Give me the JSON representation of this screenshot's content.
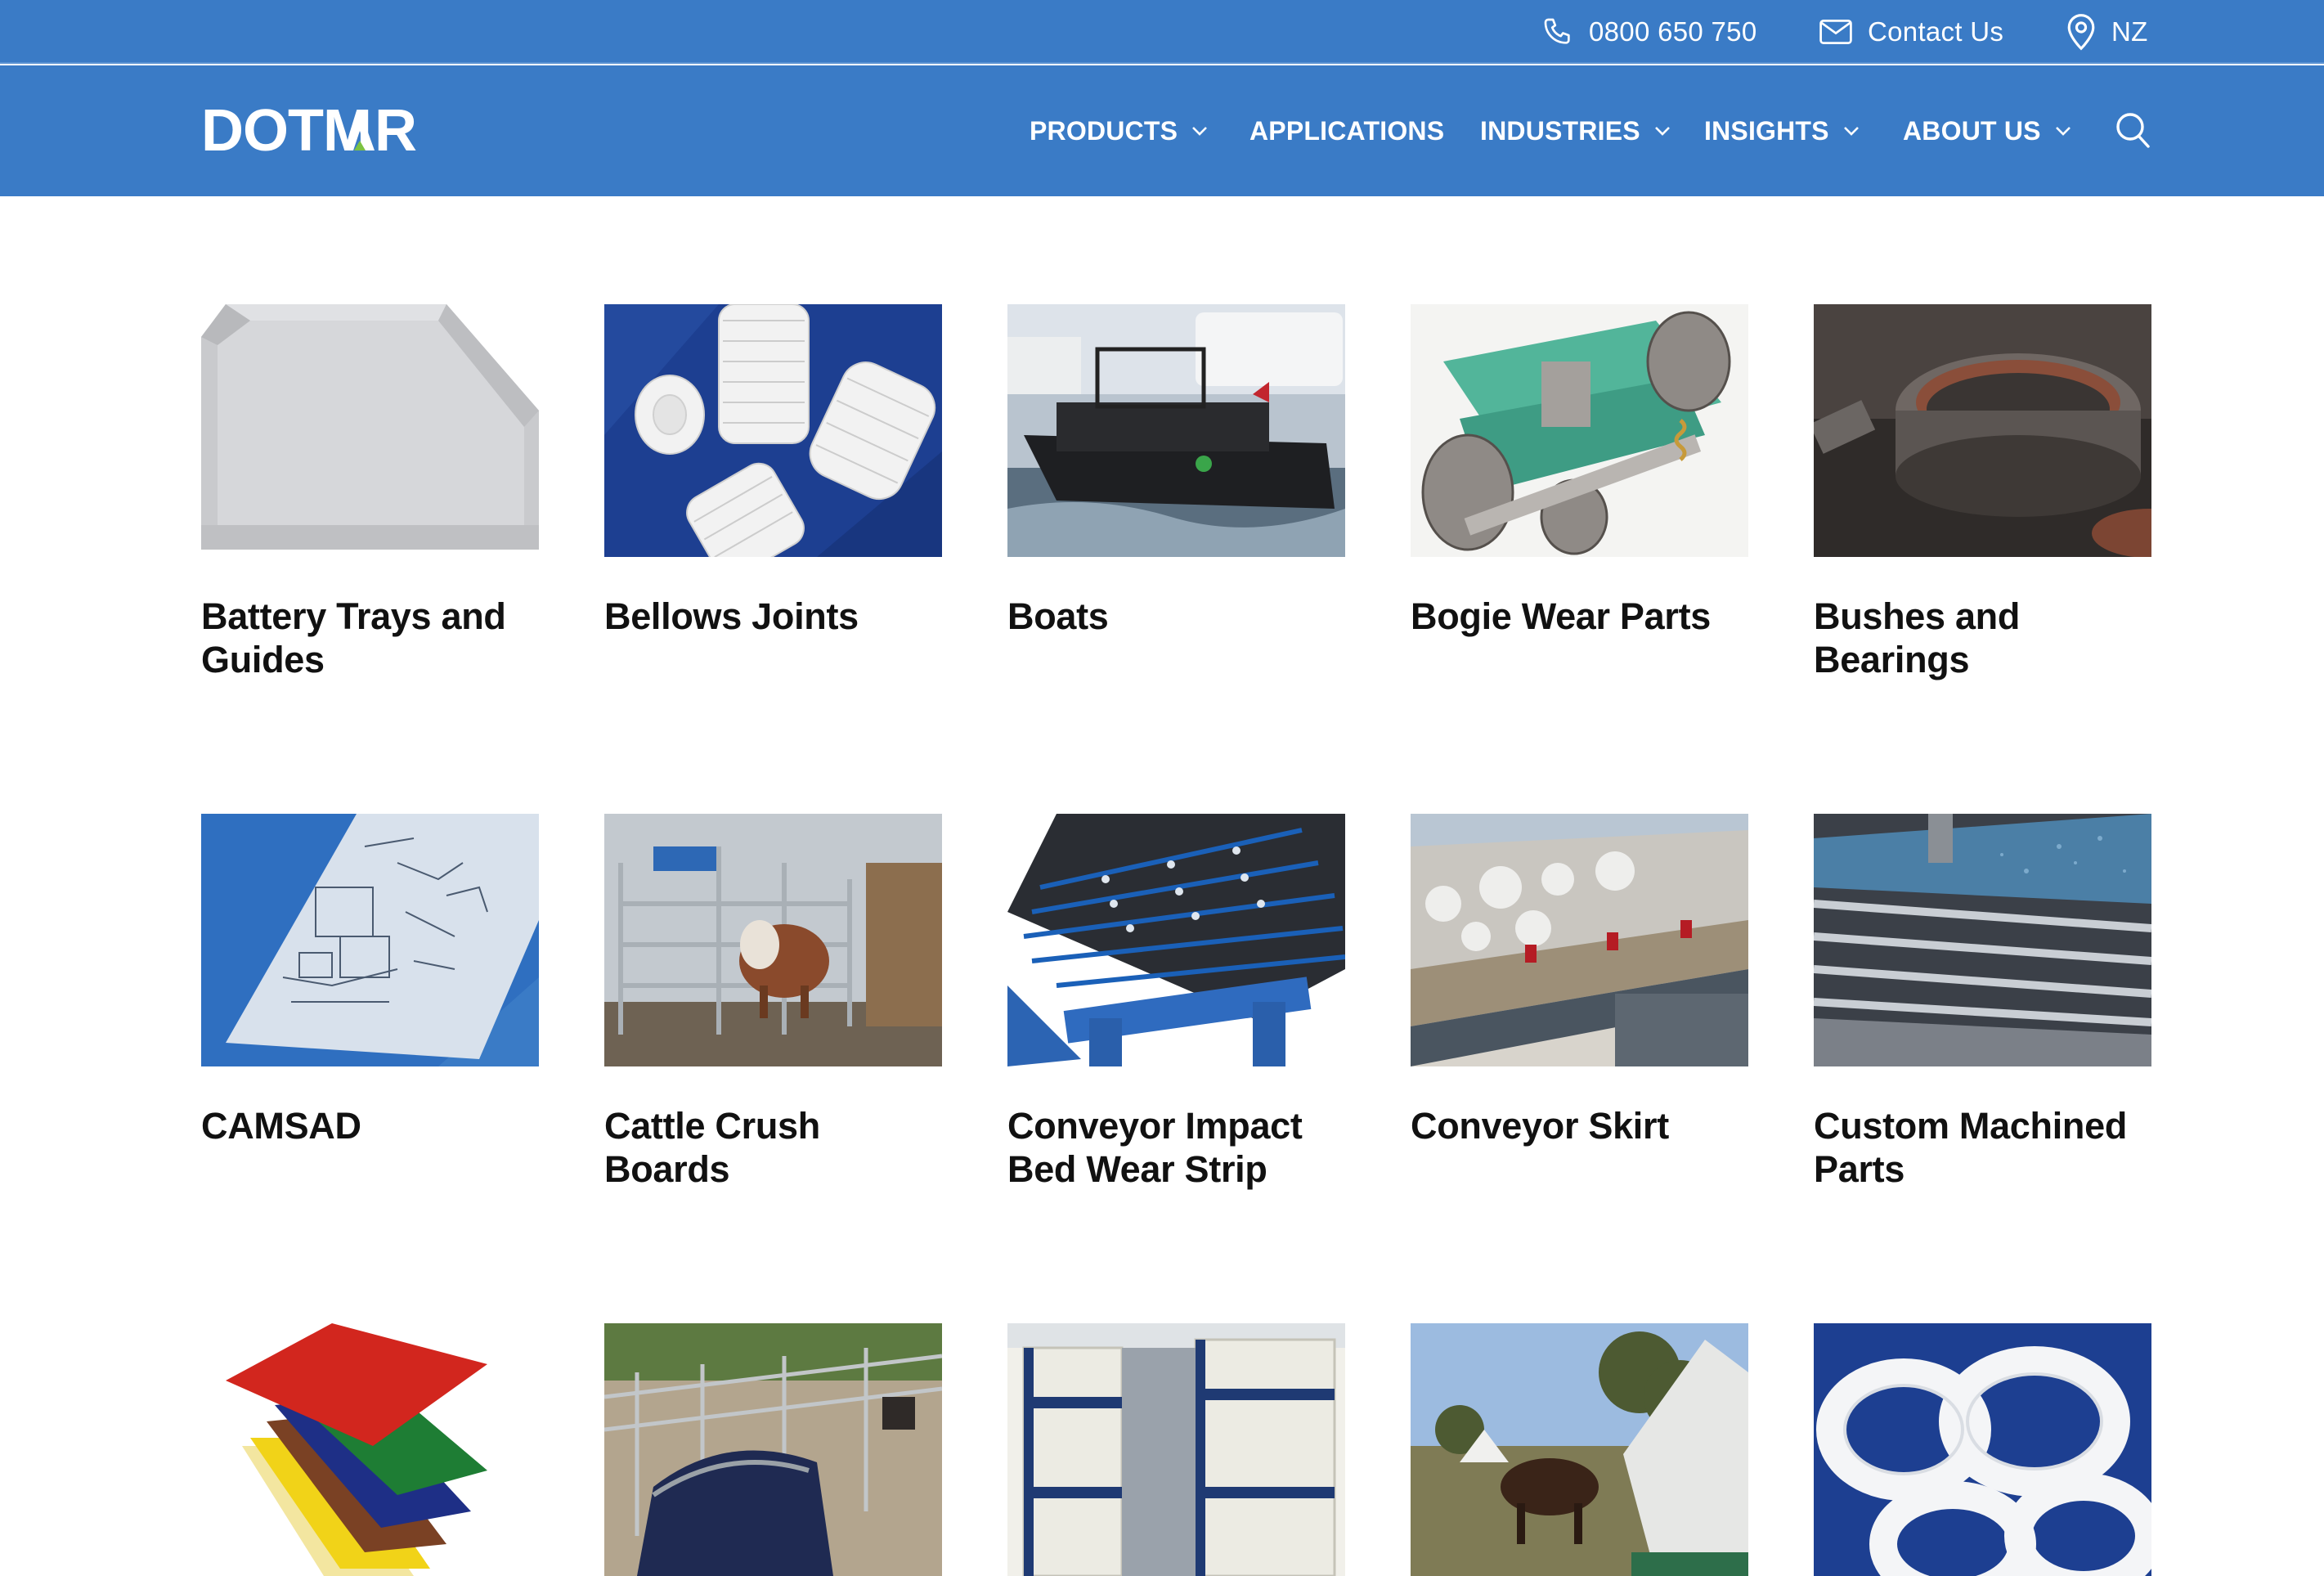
{
  "topbar": {
    "phone": "0800 650 750",
    "contact": "Contact Us",
    "region": "NZ"
  },
  "header": {
    "logo_text": "DOTMAR",
    "nav": [
      {
        "label": "PRODUCTS",
        "dropdown": true
      },
      {
        "label": "APPLICATIONS",
        "dropdown": false
      },
      {
        "label": "INDUSTRIES",
        "dropdown": true
      },
      {
        "label": "INSIGHTS",
        "dropdown": true
      },
      {
        "label": "ABOUT US",
        "dropdown": true
      }
    ]
  },
  "colors": {
    "brand_blue": "#3a7bc6",
    "logo_accent": "#7cc242"
  },
  "applications": [
    {
      "title": "Battery Trays and Guides",
      "image": "grey-plastic-tray"
    },
    {
      "title": "Bellows Joints",
      "image": "white-bellows-on-blue"
    },
    {
      "title": "Boats",
      "image": "black-rib-boat-marina"
    },
    {
      "title": "Bogie Wear Parts",
      "image": "rail-bogie-diagram"
    },
    {
      "title": "Bushes and Bearings",
      "image": "metal-bearing-rings"
    },
    {
      "title": "CAMSAD",
      "image": "technical-drawing-sheet"
    },
    {
      "title": "Cattle Crush Boards",
      "image": "cow-in-cattle-crush"
    },
    {
      "title": "Conveyor Impact Bed Wear Strip",
      "image": "impact-bed-strips"
    },
    {
      "title": "Conveyor Skirt",
      "image": "conveyor-belt-rocks"
    },
    {
      "title": "Custom Machined Parts",
      "image": "cnc-machining-bars"
    },
    {
      "title": "",
      "image": "coloured-plastic-sheets"
    },
    {
      "title": "",
      "image": "livestock-yards"
    },
    {
      "title": "",
      "image": "plastic-tanks-row"
    },
    {
      "title": "",
      "image": "cow-at-feeder"
    },
    {
      "title": "",
      "image": "white-ptfe-rings"
    }
  ]
}
